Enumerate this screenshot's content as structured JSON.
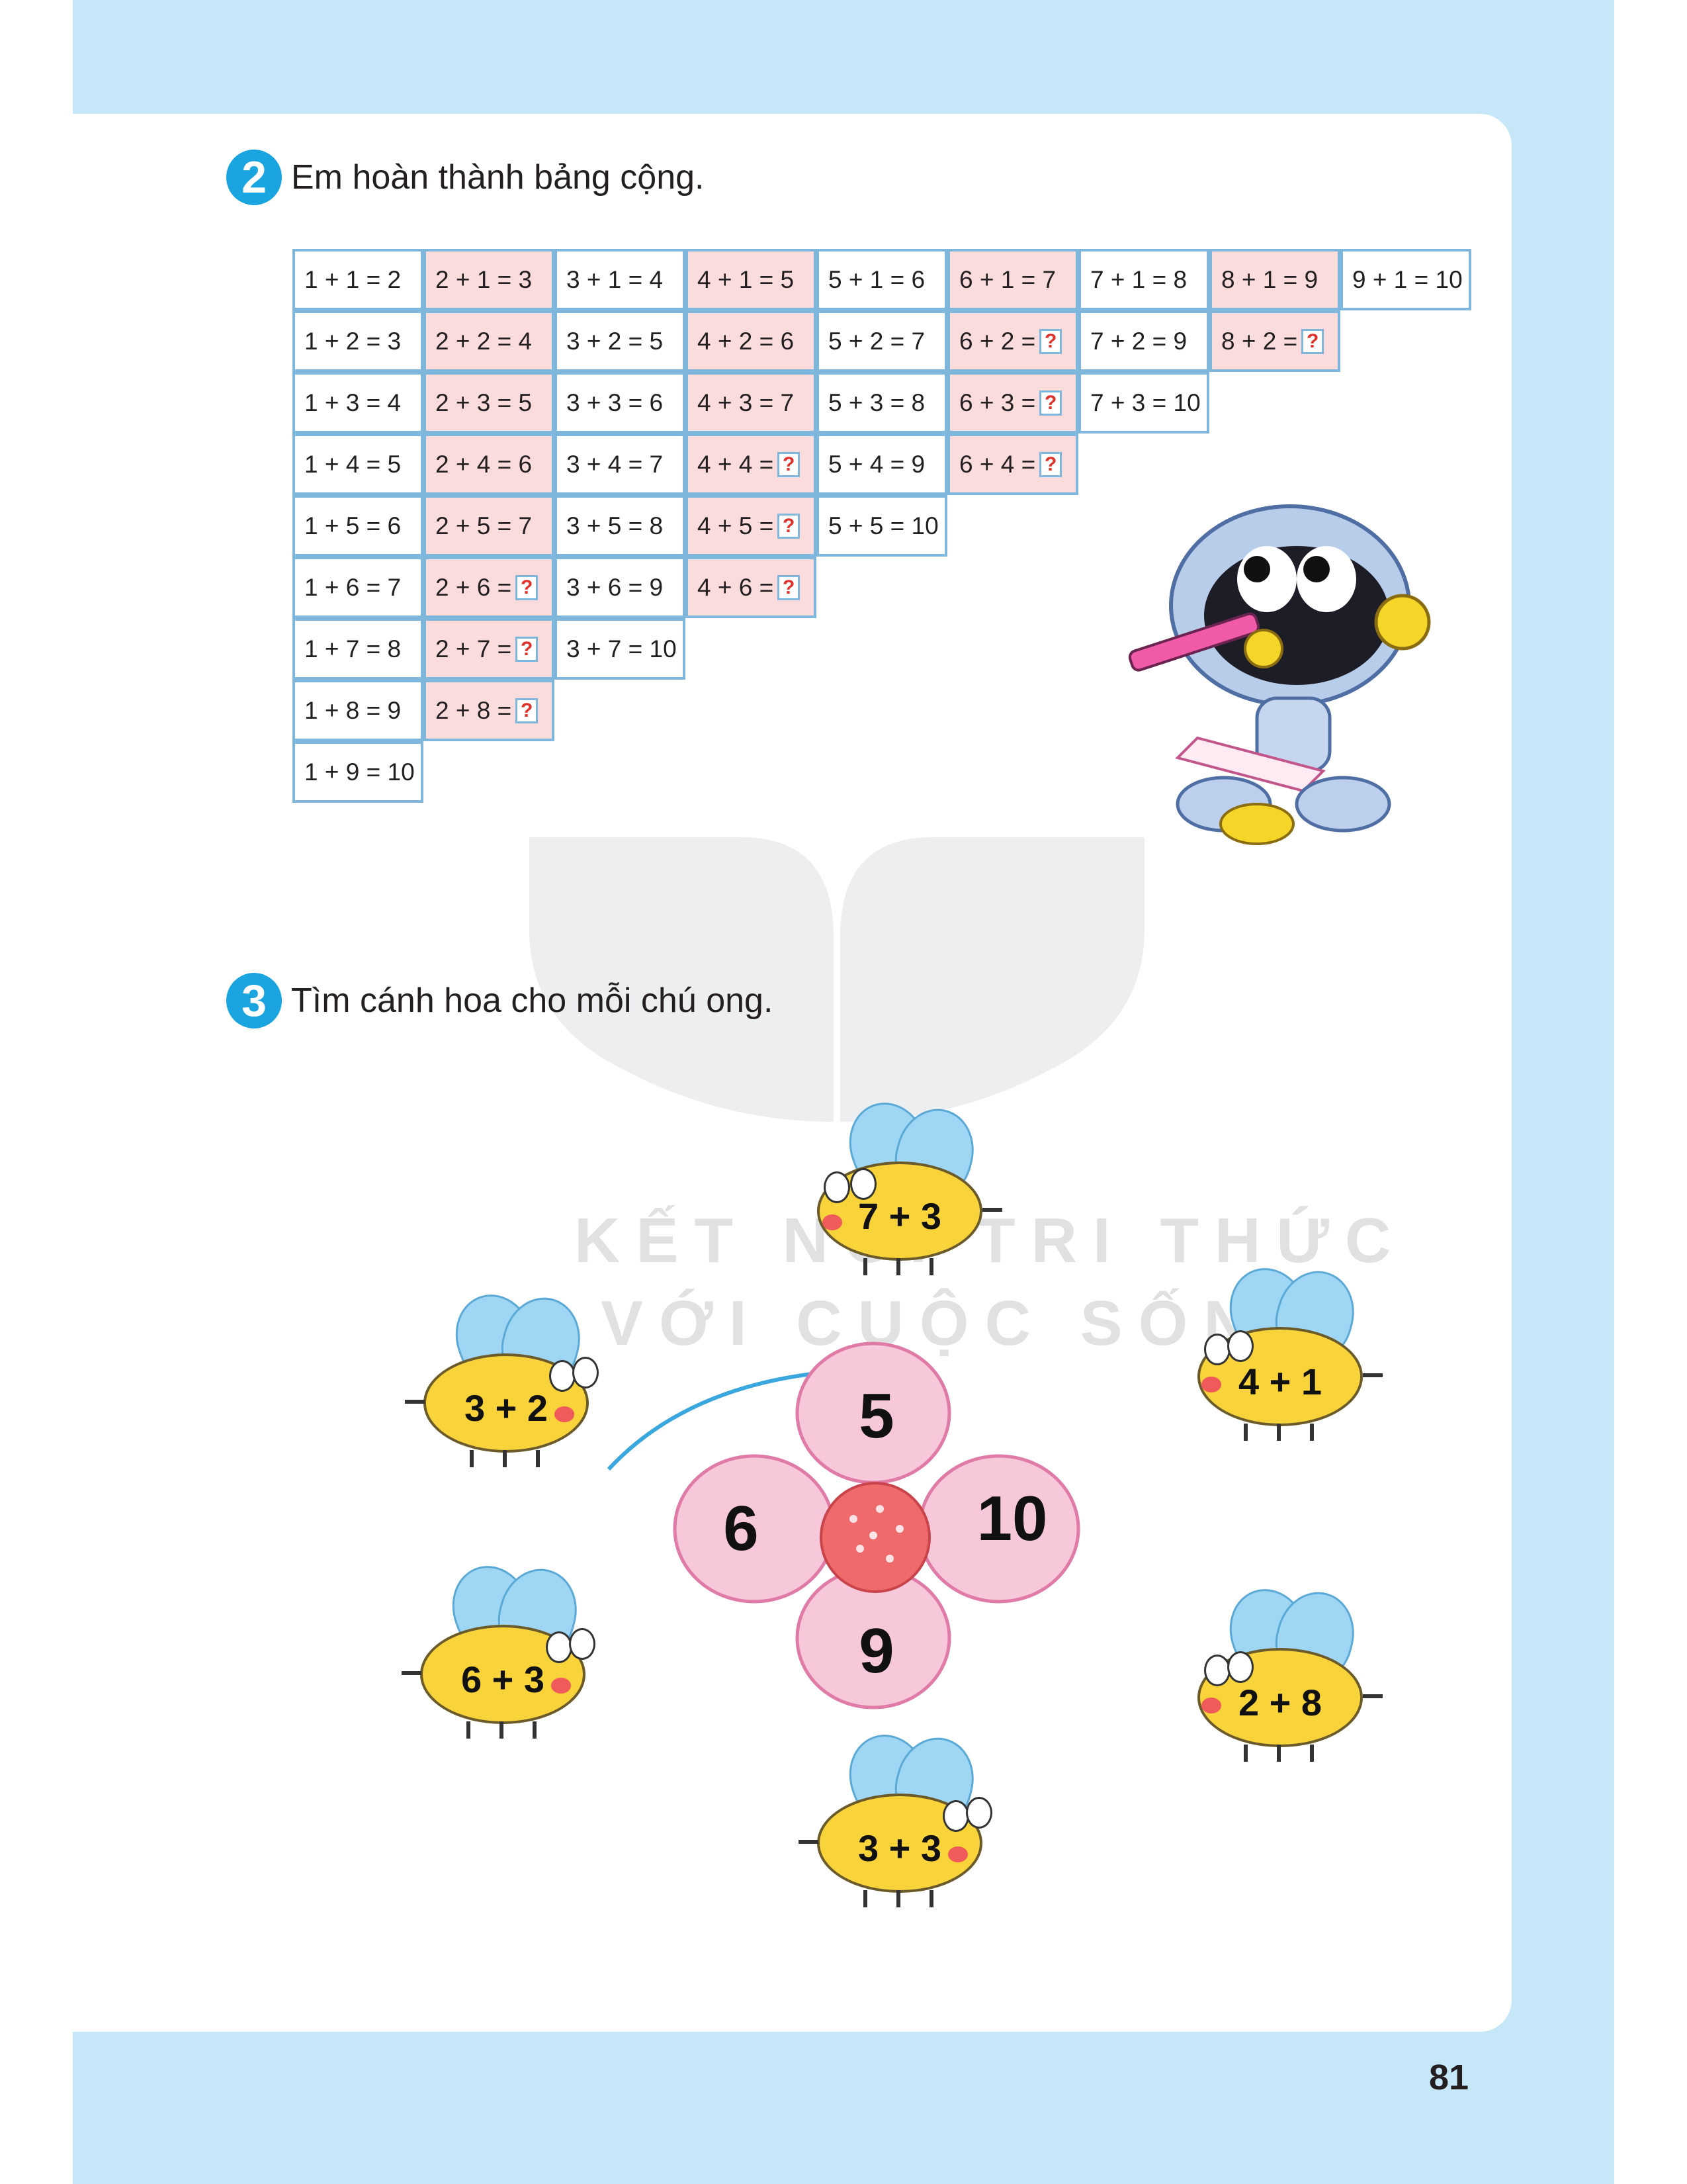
{
  "exercise2": {
    "number": "2",
    "instruction": "Em hoàn thành bảng cộng."
  },
  "table": {
    "columns": [
      [
        "1 + 1 = 2",
        "1 + 2 = 3",
        "1 + 3 = 4",
        "1 + 4 = 5",
        "1 + 5 = 6",
        "1 + 6 = 7",
        "1 + 7 = 8",
        "1 + 8 = 9",
        "1 + 9 = 10"
      ],
      [
        "2 + 1 = 3",
        "2 + 2 = 4",
        "2 + 3 = 5",
        "2 + 4 = 6",
        "2 + 5 = 7",
        "2 + 6 = ?",
        "2 + 7 = ?",
        "2 + 8 = ?"
      ],
      [
        "3 + 1 = 4",
        "3 + 2 = 5",
        "3 + 3 = 6",
        "3 + 4 = 7",
        "3 + 5 = 8",
        "3 + 6 = 9",
        "3 + 7 = 10"
      ],
      [
        "4 + 1 = 5",
        "4 + 2 = 6",
        "4 + 3 = 7",
        "4 + 4 = ?",
        "4 + 5 = ?",
        "4 + 6 = ?"
      ],
      [
        "5 + 1 = 6",
        "5 + 2 = 7",
        "5 + 3 = 8",
        "5 + 4 = 9",
        "5 + 5 = 10"
      ],
      [
        "6 + 1 = 7",
        "6 + 2 = ?",
        "6 + 3 = ?",
        "6 + 4 = ?"
      ],
      [
        "7 + 1 = 8",
        "7 + 2 = 9",
        "7 + 3 = 10"
      ],
      [
        "8 + 1 = 9",
        "8 + 2 = ?"
      ],
      [
        "9 + 1 = 10"
      ]
    ],
    "pink_columns": [
      1,
      3,
      5,
      7
    ]
  },
  "exercise3": {
    "number": "3",
    "instruction": "Tìm cánh hoa cho mỗi chú ong.",
    "petals": [
      "5",
      "6",
      "10",
      "9"
    ],
    "bees": [
      "7 + 3",
      "3 + 2",
      "4 + 1",
      "6 + 3",
      "2 + 8",
      "3 + 3"
    ]
  },
  "watermark": {
    "line1": "KẾT NỐI TRI THỨC",
    "line2": "VỚI CUỘC SỐNG"
  },
  "page_number": "81",
  "colors": {
    "frame": "#c5e7f8",
    "badge": "#1aa5e0",
    "cell_border": "#7fb7dc",
    "pink_cell": "#fbdcdc",
    "question_mark": "#e0312b"
  }
}
